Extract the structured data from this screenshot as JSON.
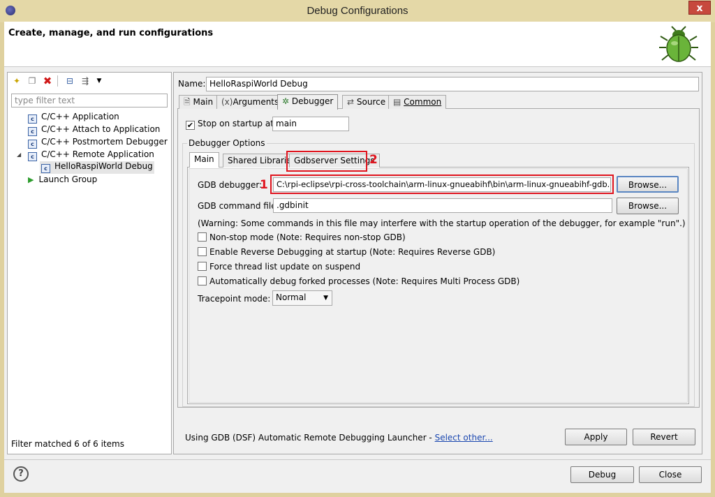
{
  "window": {
    "title": "Debug Configurations",
    "close": "x"
  },
  "header": {
    "title": "Create, manage, and run configurations"
  },
  "left": {
    "filter_placeholder": "type filter text",
    "tree": [
      {
        "label": "C/C++ Application",
        "icon": "c"
      },
      {
        "label": "C/C++ Attach to Application",
        "icon": "c"
      },
      {
        "label": "C/C++ Postmortem Debugger",
        "icon": "c"
      },
      {
        "label": "C/C++ Remote Application",
        "icon": "c"
      },
      {
        "label": "HelloRaspiWorld Debug",
        "icon": "c"
      },
      {
        "label": "Launch Group",
        "icon": "play"
      }
    ],
    "status": "Filter matched 6 of 6 items"
  },
  "right": {
    "name_label": "Name:",
    "name_value": "HelloRaspiWorld Debug",
    "tabs": [
      "Main",
      "Arguments",
      "Debugger",
      "Source",
      "Common"
    ],
    "stop_label": "Stop on startup at:",
    "stop_value": "main",
    "options_title": "Debugger Options",
    "subtabs": [
      "Main",
      "Shared Libraries",
      "Gdbserver Settings"
    ],
    "gdb_label": "GDB debugger:",
    "gdb_value": "C:\\rpi-eclipse\\rpi-cross-toolchain\\arm-linux-gnueabihf\\bin\\arm-linux-gnueabihf-gdb.exe",
    "browse1": "Browse...",
    "cmd_label": "GDB command file:",
    "cmd_value": ".gdbinit",
    "browse2": "Browse...",
    "warning": "(Warning: Some commands in this file may interfere with the startup operation of the debugger, for example \"run\".)",
    "checks": [
      "Non-stop mode (Note: Requires non-stop GDB)",
      "Enable Reverse Debugging at startup (Note: Requires Reverse GDB)",
      "Force thread list update on suspend",
      "Automatically debug forked processes (Note: Requires Multi Process GDB)"
    ],
    "tracepoint_label": "Tracepoint mode:",
    "tracepoint_value": "Normal",
    "launcher_text": "Using GDB (DSF) Automatic Remote Debugging Launcher - ",
    "launcher_link": "Select other...",
    "apply": "Apply",
    "revert": "Revert"
  },
  "annotations": {
    "one": "1",
    "two": "2"
  },
  "footer": {
    "help": "?",
    "debug": "Debug",
    "close": "Close"
  }
}
